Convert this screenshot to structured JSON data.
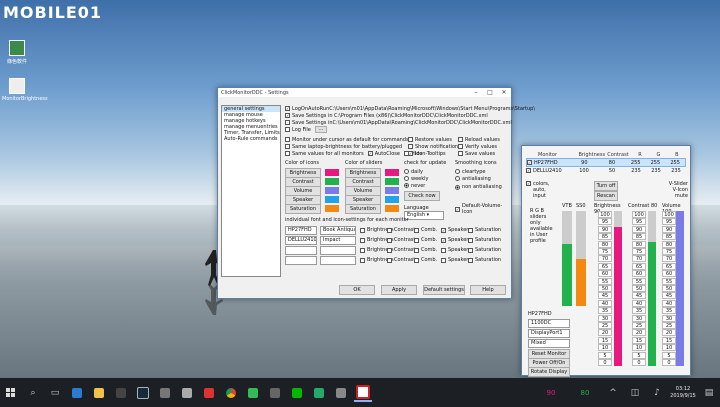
{
  "desktop": {
    "logo": "MOBILE01",
    "icons": [
      {
        "label": "綠色軟件"
      },
      {
        "label": "MonitorBrightness"
      }
    ]
  },
  "settings": {
    "title": "ClickMonitorDDC - Settings",
    "nav": [
      "general settings",
      "manage mouse",
      "manage hotkeys",
      "manage menuentries",
      "Timer, Transfer, Limits",
      "Auto-Rule commands"
    ],
    "startup": [
      {
        "label": "LogOnAutoRun",
        "path": "C:\\Users\\m01\\AppData\\Roaming\\Microsoft\\Windows\\Start Menu\\Programs\\Startup\\",
        "checked": true
      },
      {
        "label": "Save Settings in",
        "path": "C:\\Program Files (x86)\\ClickMonitorDDC\\ClickMonitorDDC.xml",
        "checked": true
      },
      {
        "label": "Save Settings in",
        "path": "C:\\Users\\m01\\AppData\\Roaming\\ClickMonitorDDC\\ClickMonitorDDC.xml",
        "checked": false
      }
    ],
    "logfile_label": "Log File",
    "options_left": [
      {
        "label": "Monitor under cursor as default for commands",
        "checked": false
      },
      {
        "label": "Same laptop-brightness for battery/plugged",
        "checked": false
      },
      {
        "label": "Same values for all monitors",
        "checked": false
      }
    ],
    "autoclose_label": "AutoClose",
    "hide_label": "Hide",
    "options_right_a": [
      {
        "label": "Restore values",
        "checked": false
      },
      {
        "label": "Show notifications",
        "checked": false
      },
      {
        "label": "Icon-Tooltips",
        "checked": true
      }
    ],
    "options_right_b": [
      {
        "label": "Reload values",
        "checked": false
      },
      {
        "label": "Verify values",
        "checked": false
      },
      {
        "label": "Save values",
        "checked": false
      }
    ],
    "icon_colors_title": "Color of icons",
    "slider_colors_title": "Color of sliders",
    "color_rows": [
      {
        "label": "Brightness",
        "icon_color": "#e6197f",
        "slider_color": "#e6197f"
      },
      {
        "label": "Contrast",
        "icon_color": "#22b14c",
        "slider_color": "#22b14c"
      },
      {
        "label": "Volume",
        "icon_color": "#7b7be8",
        "slider_color": "#7b7be8"
      },
      {
        "label": "Speaker",
        "icon_color": "#22a2e8",
        "slider_color": "#22a2e8"
      },
      {
        "label": "Saturation",
        "icon_color": "#f28a12",
        "slider_color": "#f28a12"
      }
    ],
    "update_title": "check for update",
    "update_options": [
      {
        "label": "daily",
        "checked": false
      },
      {
        "label": "weekly",
        "checked": false
      },
      {
        "label": "never",
        "checked": true
      }
    ],
    "check_now": "Check now",
    "smoothing_title": "Smoothing icons",
    "smoothing_options": [
      {
        "label": "cleartype",
        "checked": false
      },
      {
        "label": "antialiasing",
        "checked": false
      },
      {
        "label": "non antialiasing",
        "checked": true
      }
    ],
    "language_label": "Language",
    "language_value": "English",
    "default_volume_label": "Default-Volume-Icon",
    "monitor_table_title": "individual font and icon-settings for each monitor",
    "monitor_rows": [
      {
        "name": "HP27FHD",
        "font": "Book Antiqua"
      },
      {
        "name": "DELLU2410",
        "font": "Impact"
      },
      {
        "name": "",
        "font": ""
      },
      {
        "name": "",
        "font": ""
      }
    ],
    "col_labels": [
      "Brightness",
      "Contrast",
      "Comb.",
      "Speaker",
      "Saturation"
    ],
    "buttons": {
      "ok": "OK",
      "apply": "Apply",
      "default": "Default settings",
      "help": "Help"
    }
  },
  "monitor_panel": {
    "headers": [
      "Monitor",
      "Brightness",
      "Contrast",
      "R",
      "G",
      "B"
    ],
    "monitors": [
      {
        "name": "HP27FHD",
        "brightness": "90",
        "contrast": "80",
        "r": "255",
        "g": "255",
        "b": "255",
        "selected": true
      },
      {
        "name": "DELLU2410",
        "brightness": "100",
        "contrast": "50",
        "r": "235",
        "g": "235",
        "b": "235",
        "selected": false
      }
    ],
    "colors_label": "colors, auto, input",
    "turn_off": "Turn off",
    "rescan": "Rescan",
    "vslider_label": "V-Slider",
    "vicon_label": "V-Icon",
    "mute_label": "mute",
    "rgb_note": "R G B sliders only available in User profile",
    "vtb_label": "VTB",
    "sso_label": "SS0",
    "bri_label": "Brightness 90",
    "con_label": "Contrast 80",
    "vol_label": "Volume 100",
    "levels": {
      "brightness": 0.9,
      "contrast": 0.8,
      "volume": 1.0,
      "vtb": 0.65,
      "ss0": 0.5
    },
    "scale": [
      "100",
      "95",
      "90",
      "85",
      "80",
      "75",
      "70",
      "65",
      "60",
      "55",
      "50",
      "45",
      "40",
      "35",
      "30",
      "25",
      "20",
      "15",
      "10",
      "5",
      "0"
    ],
    "selected_monitor": "HP27FHD",
    "resolution": "1100DC",
    "input": "DisplayPort1",
    "mode": "Mixed",
    "reset_btn": "Reset Monitor",
    "power_btn": "Power Off/On",
    "rotate_btn": "Rotate Display",
    "colors": {
      "pink": "#e6197f",
      "green": "#22b14c",
      "blue": "#7b7be8",
      "cyan": "#22a2e8",
      "orange": "#f28a12"
    }
  },
  "taskbar": {
    "time": "03:12",
    "date": "2019/9/15",
    "apps": [
      "start-icon",
      "search-icon",
      "task-view-icon",
      "edge-icon",
      "folder-icon",
      "store-icon",
      "steam-icon",
      "app-icon",
      "app-icon",
      "app-icon",
      "chrome-icon",
      "app-icon",
      "app-icon",
      "line-icon",
      "app-icon",
      "app-icon",
      "monitor-app-icon"
    ]
  }
}
